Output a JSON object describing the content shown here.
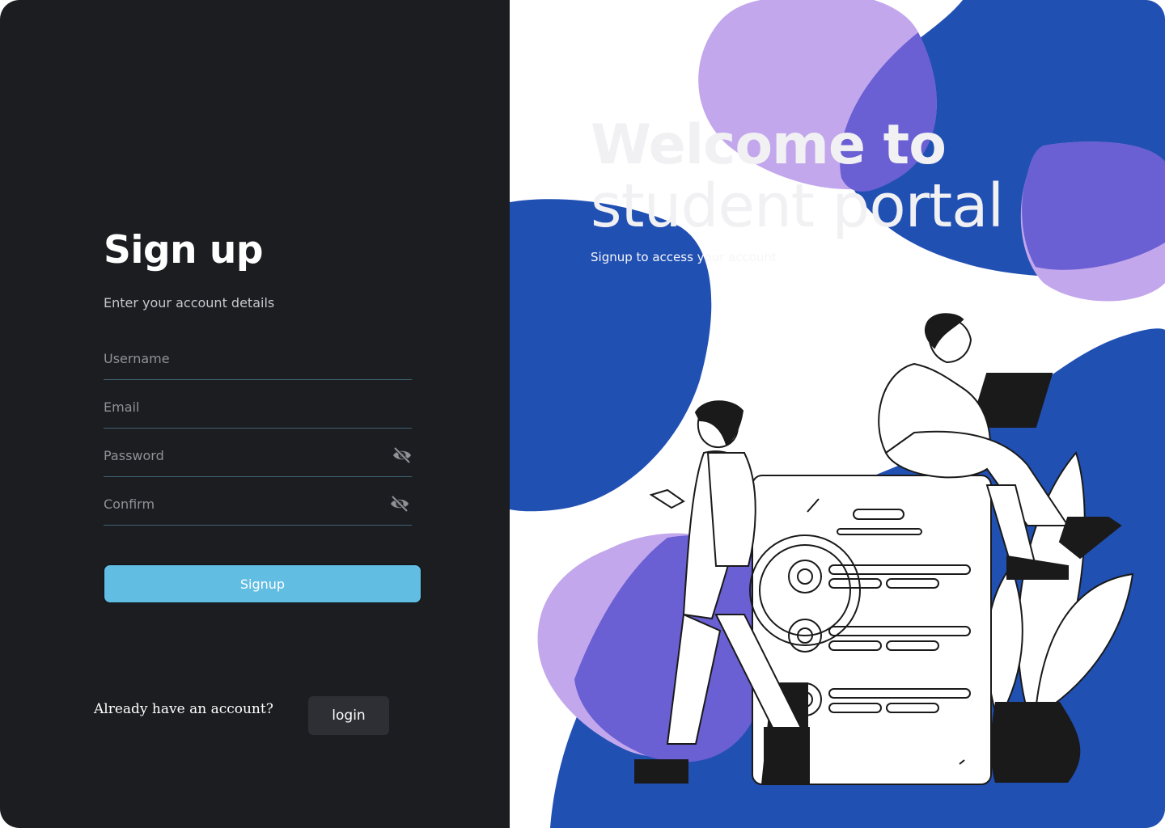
{
  "signup": {
    "title": "Sign up",
    "subtitle": "Enter your account details",
    "fields": {
      "username_placeholder": "Username",
      "email_placeholder": "Email",
      "password_placeholder": "Password",
      "confirm_placeholder": "Confirm"
    },
    "submit_label": "Signup"
  },
  "footer": {
    "question": "Already have an account?",
    "login_label": "login"
  },
  "hero": {
    "line1": "Welcome to",
    "line2": "student portal",
    "subtitle": "Signup to access your account"
  },
  "icons": {
    "password_toggle": "eye-slash-icon",
    "confirm_toggle": "eye-slash-icon"
  },
  "colors": {
    "left_bg": "#1c1d21",
    "accent_button": "#62bde2",
    "blob_blue": "#2150b3",
    "blob_lavender": "#c3a7ec",
    "blob_overlap": "#6a5fd3"
  }
}
